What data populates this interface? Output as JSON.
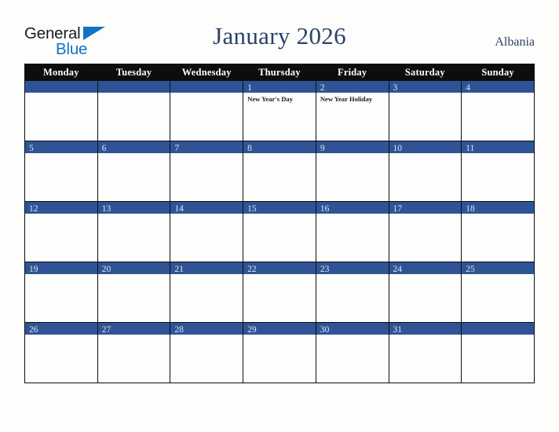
{
  "brand": {
    "line1": "General",
    "line2": "Blue",
    "line1_color": "#1c1c1c",
    "line2_color": "#1273c4",
    "triangle_color": "#1273c4"
  },
  "header": {
    "title": "January 2026",
    "country": "Albania",
    "title_color": "#2b4268"
  },
  "theme": {
    "page_background": "#fdfdfc",
    "header_row_background": "#0d0d0d",
    "header_row_text": "#ffffff",
    "day_bar_background": "#2f5496",
    "day_number_text": "#dfe6f2",
    "cell_background": "#fdfdfd",
    "grid_line": "#0d0d0d",
    "event_text": "#1b1b1b"
  },
  "weekday_headers": [
    "Monday",
    "Tuesday",
    "Wednesday",
    "Thursday",
    "Friday",
    "Saturday",
    "Sunday"
  ],
  "weeks": [
    [
      {
        "day": "",
        "events": []
      },
      {
        "day": "",
        "events": []
      },
      {
        "day": "",
        "events": []
      },
      {
        "day": "1",
        "events": [
          "New Year's Day"
        ]
      },
      {
        "day": "2",
        "events": [
          "New Year Holiday"
        ]
      },
      {
        "day": "3",
        "events": []
      },
      {
        "day": "4",
        "events": []
      }
    ],
    [
      {
        "day": "5",
        "events": []
      },
      {
        "day": "6",
        "events": []
      },
      {
        "day": "7",
        "events": []
      },
      {
        "day": "8",
        "events": []
      },
      {
        "day": "9",
        "events": []
      },
      {
        "day": "10",
        "events": []
      },
      {
        "day": "11",
        "events": []
      }
    ],
    [
      {
        "day": "12",
        "events": []
      },
      {
        "day": "13",
        "events": []
      },
      {
        "day": "14",
        "events": []
      },
      {
        "day": "15",
        "events": []
      },
      {
        "day": "16",
        "events": []
      },
      {
        "day": "17",
        "events": []
      },
      {
        "day": "18",
        "events": []
      }
    ],
    [
      {
        "day": "19",
        "events": []
      },
      {
        "day": "20",
        "events": []
      },
      {
        "day": "21",
        "events": []
      },
      {
        "day": "22",
        "events": []
      },
      {
        "day": "23",
        "events": []
      },
      {
        "day": "24",
        "events": []
      },
      {
        "day": "25",
        "events": []
      }
    ],
    [
      {
        "day": "26",
        "events": []
      },
      {
        "day": "27",
        "events": []
      },
      {
        "day": "28",
        "events": []
      },
      {
        "day": "29",
        "events": []
      },
      {
        "day": "30",
        "events": []
      },
      {
        "day": "31",
        "events": []
      },
      {
        "day": "",
        "events": []
      }
    ]
  ]
}
